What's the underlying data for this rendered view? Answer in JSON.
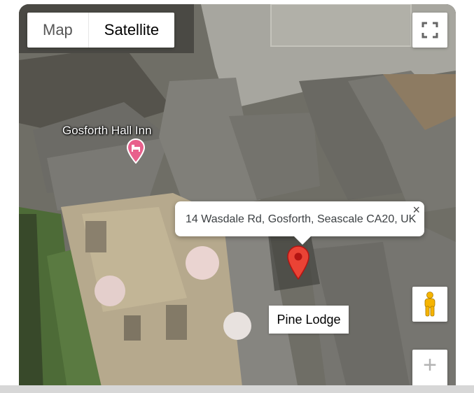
{
  "map_type_control": {
    "options": [
      "Map",
      "Satellite"
    ],
    "selected": "Satellite"
  },
  "icons": {
    "fullscreen": "fullscreen-icon",
    "poi": "hotel-marker-icon",
    "pin": "red-location-pin-icon",
    "pegman": "pegman-icon",
    "zoom_in": "plus-icon",
    "close": "close-icon"
  },
  "poi": {
    "label": "Gosforth Hall Inn"
  },
  "info_window": {
    "address": "14 Wasdale Rd, Gosforth, Seascale CA20, UK",
    "close_glyph": "×"
  },
  "place_label": "Pine Lodge",
  "zoom": {
    "in_glyph": "+"
  },
  "colors": {
    "pin_red": "#ea4335",
    "poi_pink": "#e8608c"
  }
}
